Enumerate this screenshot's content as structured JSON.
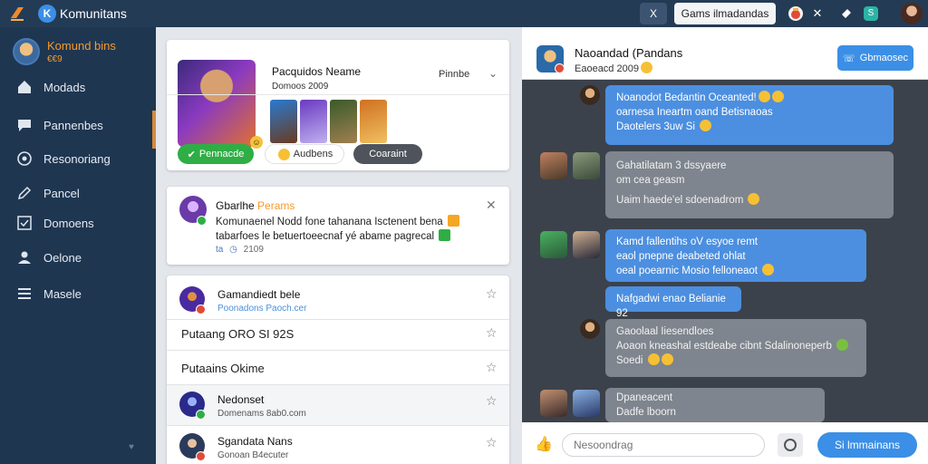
{
  "topbar": {
    "title": "Komunitans",
    "logo_badge": "K",
    "button_x": "X",
    "search_text": "Gams ilmadandas",
    "icons": [
      "shield-icon",
      "close-icon",
      "puzzle-icon",
      "app-icon",
      "user-avatar"
    ]
  },
  "sidebar": {
    "profile_name": "Komund bins",
    "profile_sub": "€€9",
    "items": [
      {
        "label": "Modads",
        "icon": "home-icon"
      },
      {
        "label": "Pannenbes",
        "icon": "chat-icon"
      },
      {
        "label": "Resonoriang",
        "icon": "target-icon"
      },
      {
        "label": "Pancel",
        "icon": "edit-icon"
      },
      {
        "label": "Domoens",
        "icon": "checkbox-icon"
      },
      {
        "label": "Oelone",
        "icon": "user-icon"
      },
      {
        "label": "Masele",
        "icon": "list-icon"
      }
    ],
    "footer": "♥"
  },
  "game_card": {
    "title": "Pacquidos Neame",
    "subtitle": "Domoos 2009",
    "select_value": "Pinnbe",
    "btn_green": "Pennacde",
    "btn_white": "Audbens",
    "btn_dark": "Coaraint"
  },
  "post1": {
    "author": "Gbarlhe",
    "author_tag": "Perams",
    "line1": "Komunaenel Nodd fone tahanana Isctenent bena",
    "line2": "tabarfoes le betuertoeecnaf yé abame pagrecal",
    "meta_prefix": "ta",
    "meta_time": "2109"
  },
  "list": [
    {
      "title": "Gamandiedt bele",
      "sub": "Poonadons Paoch.cer",
      "type": "avatar"
    },
    {
      "title": "Putaang ORO SI 92S",
      "sub": "",
      "type": "text"
    },
    {
      "title": "Putaains Okime",
      "sub": "",
      "type": "text"
    },
    {
      "title": "Nedonset",
      "sub": "Domenams 8ab0.com",
      "type": "avatar"
    },
    {
      "title": "Sgandata Nans",
      "sub": "Gonoan B4ecuter",
      "type": "avatar"
    }
  ],
  "chat": {
    "contact_name": "Naoandad (Pandans",
    "contact_sub": "Eaoeacd 2009",
    "action_button": "Gbmaosec",
    "messages": [
      {
        "side": "blue",
        "lines": [
          "Noanodot Bedantin Oceanted!",
          "oarnesa Ineartm oand Betisnaoas",
          "Daotelers 3uw Si"
        ]
      },
      {
        "side": "gray",
        "lines": [
          "Gahatilatam 3 dssyaere",
          "om cea geasm",
          "Uaim haede'el sdoenadrom"
        ]
      },
      {
        "side": "blue",
        "lines": [
          "Kamd fallentihs oV esyoe remt",
          "eaol pnepne deabeted ohlat",
          "oeal poearnic Mosio felloneaot"
        ]
      },
      {
        "side": "blue",
        "lines": [
          "Nafgadwi enao Belianie 92"
        ]
      },
      {
        "side": "gray",
        "lines": [
          "Gaoolaal Iiesendloes",
          "Aoaon kneashal estdeabe cibnt Sdalinoneperb",
          "Soedi"
        ]
      },
      {
        "side": "gray",
        "lines": [
          "Dpaneacent",
          "Dadfe lboorn"
        ]
      }
    ],
    "input_placeholder": "Nesoondrag",
    "send_label": "Si lmmainans"
  },
  "colors": {
    "topbar": "#243b55",
    "sidebar": "#1f3651",
    "accent_orange": "#f59a2c",
    "bubble_blue": "#4c8fe0",
    "bubble_gray": "#7f858e",
    "green": "#2fae45"
  }
}
